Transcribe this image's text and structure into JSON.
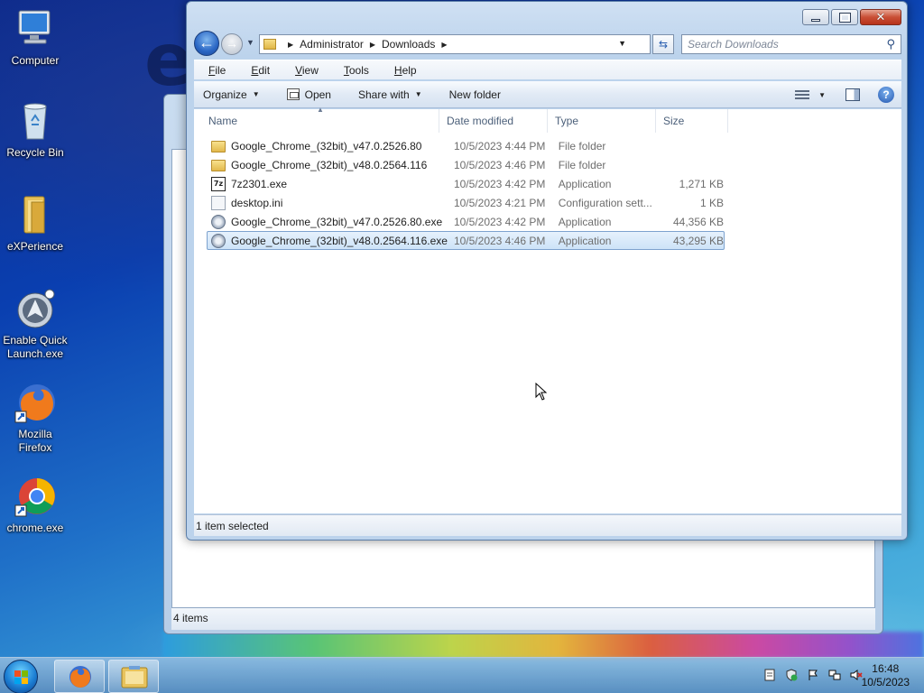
{
  "desktop": {
    "icons": [
      {
        "label": "Computer",
        "icon": "computer-icon"
      },
      {
        "label": "Recycle Bin",
        "icon": "recycle-bin-icon"
      },
      {
        "label": "eXPerience",
        "icon": "folder-icon"
      },
      {
        "label": "Enable Quick Launch.exe",
        "icon": "quick-launch-icon"
      },
      {
        "label": "Mozilla Firefox",
        "icon": "firefox-icon"
      },
      {
        "label": "chrome.exe",
        "icon": "chrome-icon"
      }
    ]
  },
  "background_window": {
    "status": "4 items"
  },
  "explorer": {
    "breadcrumb": [
      "Administrator",
      "Downloads"
    ],
    "search_placeholder": "Search Downloads",
    "menu": [
      "File",
      "Edit",
      "View",
      "Tools",
      "Help"
    ],
    "menu_mnemonics": [
      "F",
      "E",
      "V",
      "T",
      "H"
    ],
    "commands": {
      "organize": "Organize",
      "open": "Open",
      "share_with": "Share with",
      "new_folder": "New folder"
    },
    "columns": [
      "Name",
      "Date modified",
      "Type",
      "Size"
    ],
    "files": [
      {
        "name": "Google_Chrome_(32bit)_v47.0.2526.80",
        "date": "10/5/2023 4:44 PM",
        "type": "File folder",
        "size": "",
        "icon": "folder-icon",
        "selected": false
      },
      {
        "name": "Google_Chrome_(32bit)_v48.0.2564.116",
        "date": "10/5/2023 4:46 PM",
        "type": "File folder",
        "size": "",
        "icon": "folder-icon",
        "selected": false
      },
      {
        "name": "7z2301.exe",
        "date": "10/5/2023 4:42 PM",
        "type": "Application",
        "size": "1,271 KB",
        "icon": "7zip-icon",
        "selected": false
      },
      {
        "name": "desktop.ini",
        "date": "10/5/2023 4:21 PM",
        "type": "Configuration sett...",
        "size": "1 KB",
        "icon": "ini-file-icon",
        "selected": false
      },
      {
        "name": "Google_Chrome_(32bit)_v47.0.2526.80.exe",
        "date": "10/5/2023 4:42 PM",
        "type": "Application",
        "size": "44,356 KB",
        "icon": "installer-icon",
        "selected": false
      },
      {
        "name": "Google_Chrome_(32bit)_v48.0.2564.116.exe",
        "date": "10/5/2023 4:46 PM",
        "type": "Application",
        "size": "43,295 KB",
        "icon": "installer-icon",
        "selected": true
      }
    ],
    "status": "1 item selected"
  },
  "taskbar": {
    "time": "16:48",
    "date": "10/5/2023"
  },
  "colors": {
    "selection_bg": "#cde3f8",
    "selection_border": "#7da2ce",
    "window_frame": "#bcd3ec"
  }
}
